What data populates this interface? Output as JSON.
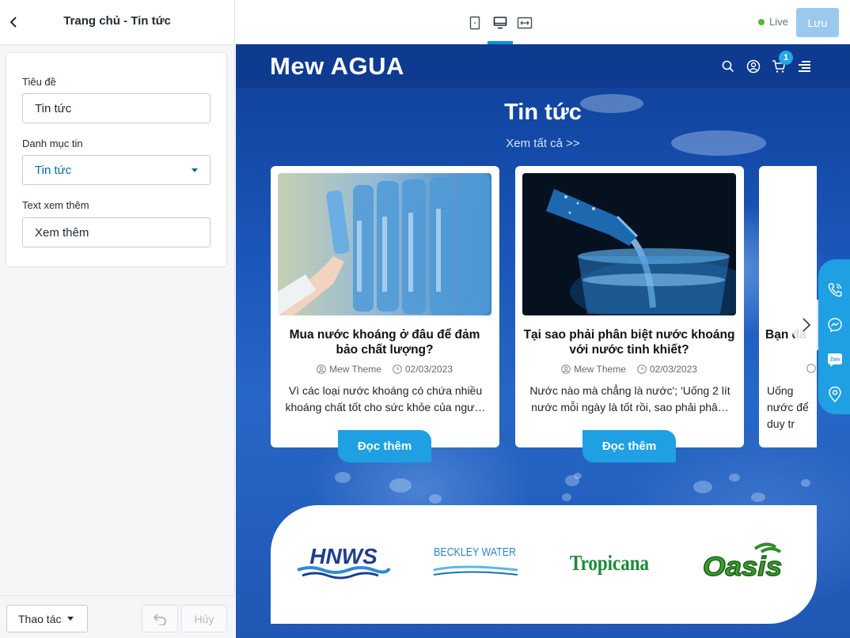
{
  "sidebar": {
    "title": "Trang chủ - Tin tức",
    "fields": {
      "title_label": "Tiêu đề",
      "title_value": "Tin tức",
      "category_label": "Danh mục tin",
      "category_value": "Tin tức",
      "more_label": "Text xem thêm",
      "more_value": "Xem thêm"
    },
    "footer": {
      "actions_label": "Thao tác",
      "cancel_label": "Hủy"
    }
  },
  "topbar": {
    "devices": [
      "mobile-icon",
      "desktop-icon",
      "fullwidth-icon"
    ],
    "active_device": "desktop-icon",
    "live_label": "Live",
    "save_label": "Lưu",
    "colors": {
      "live": "#50b83c",
      "save_bg": "#9ac8ee",
      "accent": "#1090e0"
    }
  },
  "site": {
    "logo": "Mew AGUA",
    "cart_count": "1",
    "section_title": "Tin tức",
    "see_all": "Xem tất cả >>",
    "articles": [
      {
        "title": "Mua nước khoáng ở đâu để đảm bảo chất lượng?",
        "author": "Mew Theme",
        "date": "02/03/2023",
        "excerpt": "Vì các loại nước khoáng có chứa nhiều khoáng chất tốt cho sức khỏe của ngư…",
        "button": "Đọc thêm"
      },
      {
        "title": "Tại sao phải phân biệt nước khoáng với nước tinh khiết?",
        "author": "Mew Theme",
        "date": "02/03/2023",
        "excerpt": "Nước nào mà chẳng là nước'; 'Uống 2 lít nước mỗi ngày là tốt rồi, sao phải phâ…",
        "button": "Đọc thêm"
      },
      {
        "title": "Bạn đã",
        "author": "",
        "date": "",
        "excerpt": "Uống nước để duy tr",
        "button": ""
      }
    ],
    "brands": [
      "HNWS",
      "BECKLEY WATER",
      "Tropicana",
      "Oasis"
    ],
    "float_icons": [
      "phone-icon",
      "messenger-icon",
      "zalo-icon",
      "location-icon"
    ],
    "colors": {
      "header": "#0e3a90",
      "accent": "#1ea0e3",
      "tropicana": "#1a8a3a",
      "oasis": "#2f8d2a",
      "hnws": "#1f3f8c"
    }
  }
}
